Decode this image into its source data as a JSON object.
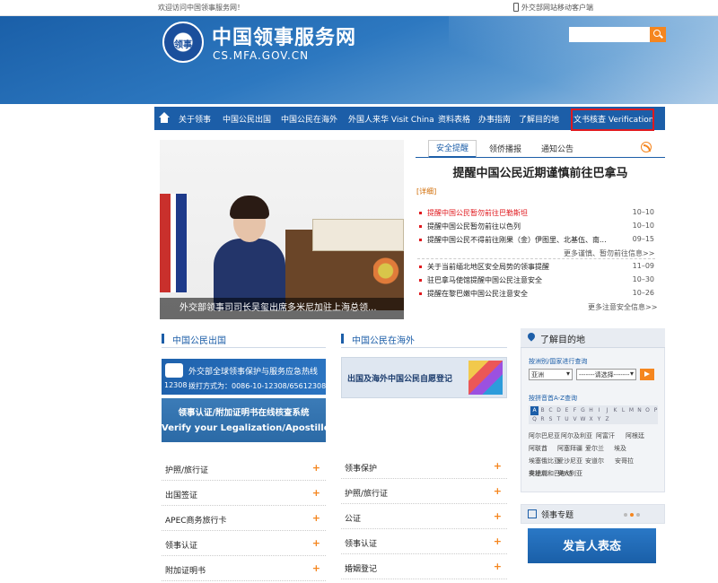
{
  "topbar": {
    "welcome": "欢迎访问中国领事服务网！",
    "mobile": "外交部网站移动客户端"
  },
  "header": {
    "title": "中国领事服务网",
    "domain": "CS.MFA.GOV.CN",
    "search_placeholder": ""
  },
  "nav": {
    "items": [
      "关于领事",
      "中国公民出国",
      "中国公民在海外",
      "外国人来华 Visit China",
      "资料表格",
      "办事指南",
      "了解目的地",
      "文书核查 Verification"
    ]
  },
  "banner": {
    "caption": "外交部领事司司长吴玺出席多米尼加驻上海总领..."
  },
  "notice": {
    "tabs": [
      "安全提醒",
      "领侨播报",
      "通知公告"
    ],
    "headline": "提醒中国公民近期谨慎前往巴拿马",
    "detail": "[详细]",
    "items_a": [
      {
        "title": "提醒中国公民暂勿前往巴勒斯坦",
        "date": "",
        "red": true
      },
      {
        "title": "提醒中国公民暂勿前往以色列",
        "date": "10–10",
        "red": false
      },
      {
        "title": "提醒中国公民不得前往刚果（金）伊图里、北基伍、南...",
        "date": "09–15",
        "red": false
      }
    ],
    "more_a": "更多谨慎、暂勿前往信息>>",
    "items_b": [
      {
        "title": "关于当前缅北地区安全局势的领事提醒",
        "date": "11–09"
      },
      {
        "title": "驻巴拿马使馆提醒中国公民注意安全",
        "date": "10–30"
      },
      {
        "title": "提醒在黎巴嫩中国公民注意安全",
        "date": "10–26"
      }
    ],
    "more_b": "更多注意安全信息>>",
    "date_first": "10–10"
  },
  "sections": {
    "outbound": "中国公民出国",
    "overseas": "中国公民在海外",
    "destination": "了解目的地",
    "special": "领事专题"
  },
  "hotline": {
    "title": "外交部全球领事保护与服务应急热线",
    "num": "12308",
    "phone": "拨打方式为：0086-10-12308/65612308"
  },
  "legalize": {
    "cn": "领事认证/附加证明书在线核查系统",
    "en": "Verify your Legalization/Apostille"
  },
  "selfreg": {
    "label": "出国及海外中国公民自愿登记"
  },
  "list_left": [
    "护照/旅行证",
    "出国签证",
    "APEC商务旅行卡",
    "领事认证",
    "附加证明书"
  ],
  "list_right": [
    "领事保护",
    "护照/旅行证",
    "公证",
    "领事认证",
    "婚姻登记"
  ],
  "dest": {
    "by_region": "按洲别/国家进行查询",
    "region_value": "亚洲",
    "country_value": "-------请选择-------",
    "by_alpha": "按拼音首A-Z查询",
    "letters": [
      "A",
      "B",
      "C",
      "D",
      "E",
      "F",
      "G",
      "H",
      "I",
      "J",
      "K",
      "L",
      "M",
      "N",
      "O",
      "P",
      "Q",
      "R",
      "S",
      "T",
      "U",
      "V",
      "W",
      "X",
      "Y",
      "Z"
    ],
    "countries": [
      "阿尔巴尼亚",
      "阿尔及利亚",
      "阿富汗",
      "阿根廷",
      "阿联酋",
      "阿塞拜疆",
      "爱尔兰",
      "埃及",
      "埃塞俄比亚",
      "爱沙尼亚",
      "安道尔",
      "安哥拉",
      "安提瓜和巴布达",
      "奥大利亚",
      "奥地利"
    ]
  },
  "spokes": {
    "label": "发言人表态"
  },
  "colors": {
    "brand": "#1c5ea8",
    "accent": "#f5861f",
    "alert": "#e0191e"
  }
}
